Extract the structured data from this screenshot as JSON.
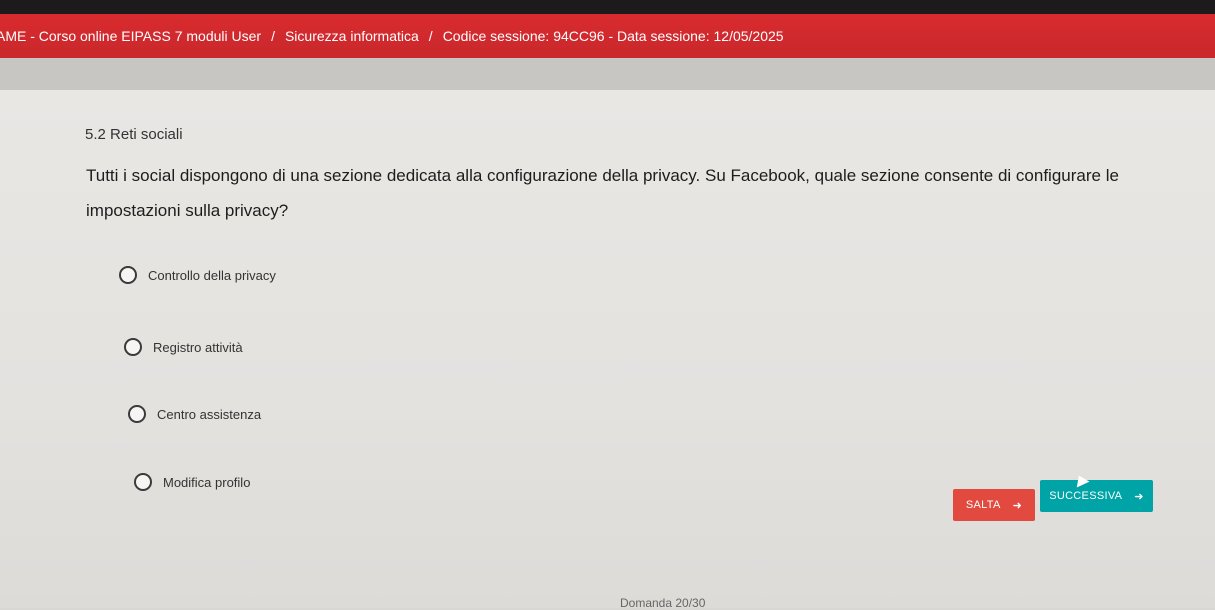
{
  "header": {
    "crumbs": [
      "AME - Corso online EIPASS 7 moduli User",
      "Sicurezza informatica",
      "Codice sessione: 94CC96 - Data sessione: 12/05/2025"
    ],
    "separator": "/"
  },
  "question": {
    "section": "5.2 Reti sociali",
    "text": "Tutti i social dispongono di una sezione dedicata alla configurazione della privacy. Su Facebook, quale sezione consente di configurare le impostazioni sulla privacy?"
  },
  "options": [
    {
      "label": "Controllo della privacy"
    },
    {
      "label": "Registro attività"
    },
    {
      "label": "Centro assistenza"
    },
    {
      "label": "Modifica profilo"
    }
  ],
  "buttons": {
    "skip": "SALTA",
    "next": "SUCCESSIVA",
    "arrow": "➜"
  },
  "footer": {
    "counter": "Domanda 20/30"
  },
  "colors": {
    "header": "#d92b2f",
    "skip": "#e24a40",
    "next": "#00a3a6"
  }
}
